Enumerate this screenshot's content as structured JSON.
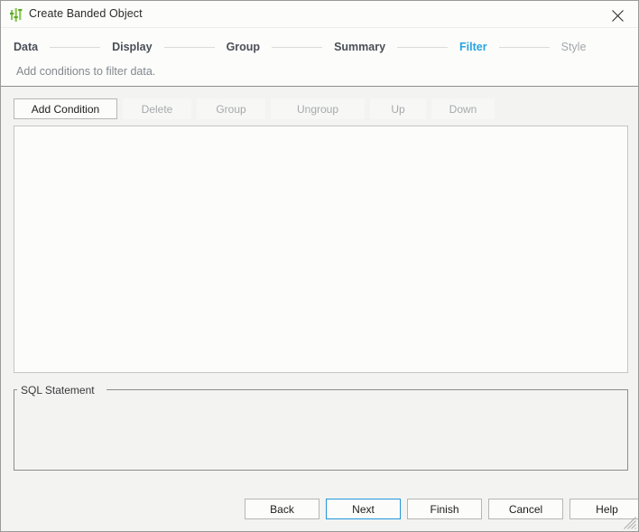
{
  "window": {
    "title": "Create Banded Object",
    "app_icon": "bar-chart-icon",
    "close_label": "✕",
    "accent_color": "#28a4e2",
    "icon_color": "#7ac143",
    "body_background": "#f3f4f2",
    "panel_background": "#fcfdfb"
  },
  "steps": {
    "items": [
      {
        "label": "Data",
        "state": "done"
      },
      {
        "label": "Display",
        "state": "done"
      },
      {
        "label": "Group",
        "state": "done"
      },
      {
        "label": "Summary",
        "state": "done"
      },
      {
        "label": "Filter",
        "state": "active"
      },
      {
        "label": "Style",
        "state": "disabled"
      }
    ],
    "subtitle": "Add conditions to filter data."
  },
  "toolbar": {
    "buttons": [
      {
        "label": "Add Condition",
        "enabled": true,
        "width_class": "w-add"
      },
      {
        "label": "Delete",
        "enabled": false,
        "width_class": "w-del"
      },
      {
        "label": "Group",
        "enabled": false,
        "width_class": "w-grp"
      },
      {
        "label": "Ungroup",
        "enabled": false,
        "width_class": "w-ung"
      },
      {
        "label": "Up",
        "enabled": false,
        "width_class": "w-up"
      },
      {
        "label": "Down",
        "enabled": false,
        "width_class": "w-dn"
      }
    ]
  },
  "conditions_panel": {
    "items": [],
    "empty_text": ""
  },
  "sql_statement": {
    "legend": "SQL Statement",
    "value": ""
  },
  "footer": {
    "buttons": [
      {
        "label": "Back",
        "primary": false
      },
      {
        "label": "Next",
        "primary": true
      },
      {
        "label": "Finish",
        "primary": false
      },
      {
        "label": "Cancel",
        "primary": false
      },
      {
        "label": "Help",
        "primary": false
      }
    ]
  }
}
